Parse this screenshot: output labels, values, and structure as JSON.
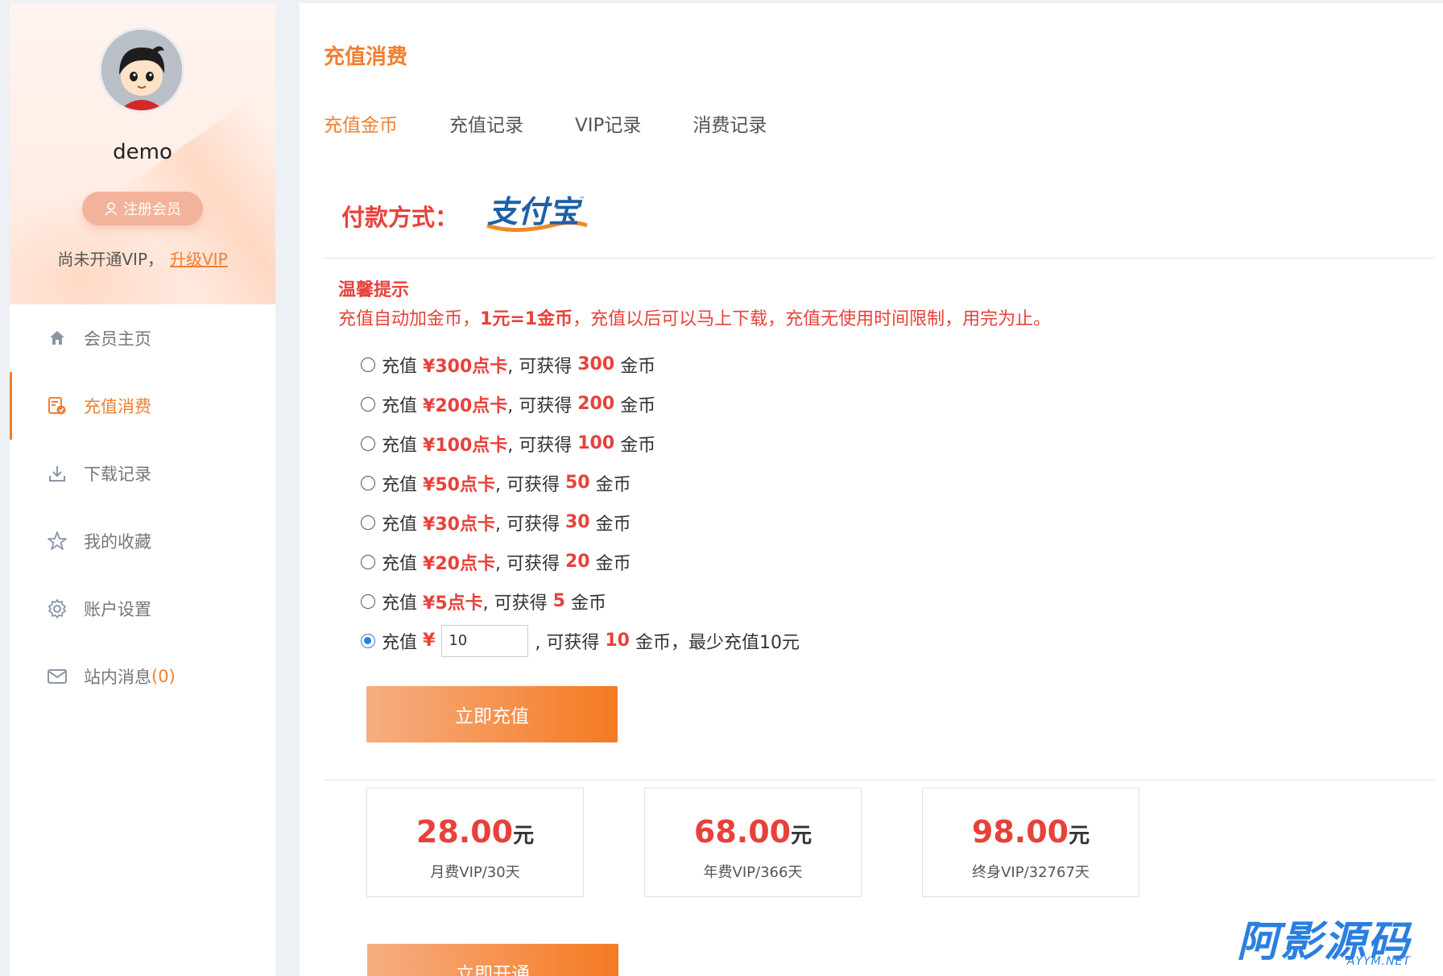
{
  "user": {
    "name": "demo",
    "badge_label": "注册会员",
    "vip_status": "尚未开通VIP，",
    "upgrade_link": "升级VIP"
  },
  "sidebar": {
    "items": [
      {
        "label": "会员主页",
        "icon": "home-icon"
      },
      {
        "label": "充值消费",
        "icon": "recharge-icon",
        "active": true
      },
      {
        "label": "下载记录",
        "icon": "download-icon"
      },
      {
        "label": "我的收藏",
        "icon": "star-icon"
      },
      {
        "label": "账户设置",
        "icon": "gear-icon"
      },
      {
        "label": "站内消息",
        "icon": "mail-icon",
        "count": "(0)"
      }
    ]
  },
  "main": {
    "title": "充值消费",
    "tabs": [
      "充值金币",
      "充值记录",
      "VIP记录",
      "消费记录"
    ],
    "active_tab": 0,
    "payment": {
      "label": "付款方式：",
      "logo_text": "支付宝"
    },
    "tip": {
      "title": "温馨提示",
      "text_before": "充值自动加金币，",
      "text_bold": "1元=1金币",
      "text_after": "，充值以后可以马上下载，充值无使用时间限制，用完为止。"
    },
    "options": [
      {
        "prefix": "充值",
        "card": "¥300点卡",
        "mid": ", 可获得",
        "coins": "300",
        "suffix": "金币"
      },
      {
        "prefix": "充值",
        "card": "¥200点卡",
        "mid": ", 可获得",
        "coins": "200",
        "suffix": "金币"
      },
      {
        "prefix": "充值",
        "card": "¥100点卡",
        "mid": ", 可获得",
        "coins": "100",
        "suffix": "金币"
      },
      {
        "prefix": "充值",
        "card": "¥50点卡",
        "mid": ", 可获得",
        "coins": "50",
        "suffix": "金币"
      },
      {
        "prefix": "充值",
        "card": "¥30点卡",
        "mid": ", 可获得",
        "coins": "30",
        "suffix": "金币"
      },
      {
        "prefix": "充值",
        "card": "¥20点卡",
        "mid": ", 可获得",
        "coins": "20",
        "suffix": "金币"
      },
      {
        "prefix": "充值",
        "card": "¥5点卡",
        "mid": ", 可获得",
        "coins": "5",
        "suffix": "金币"
      }
    ],
    "custom": {
      "prefix": "充值",
      "currency": "¥",
      "value": "10",
      "mid": ", 可获得",
      "coins": "10",
      "suffix": "金币，最少充值10元"
    },
    "recharge_button": "立即充值",
    "vip_plans": [
      {
        "price": "28.00",
        "unit": "元",
        "name": "月费VIP/30天"
      },
      {
        "price": "68.00",
        "unit": "元",
        "name": "年费VIP/366天"
      },
      {
        "price": "98.00",
        "unit": "元",
        "name": "终身VIP/32767天"
      }
    ],
    "open_button": "立即开通"
  },
  "watermark": {
    "main": "阿影源码",
    "sub": "AYYM.NET"
  },
  "colors": {
    "accent": "#f07f2f",
    "red": "#e8413a",
    "link_blue": "#2a7fe0"
  }
}
